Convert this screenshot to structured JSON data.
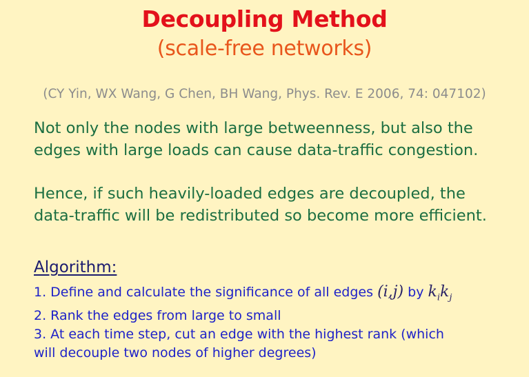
{
  "slide": {
    "title": "Decoupling Method",
    "subtitle": "(scale-free networks)",
    "citation": "(CY Yin, WX Wang, G Chen, BH Wang, Phys. Rev. E 2006, 74: 047102)",
    "paragraph1": {
      "line1": "Not only the nodes with large betweenness, but also the",
      "line2": "edges with large loads can cause data-traffic congestion."
    },
    "paragraph2": {
      "line1": "Hence, if such heavily-loaded edges are decoupled, the",
      "line2": "data-traffic will be redistributed so become more efficient."
    },
    "algorithm": {
      "heading": "Algorithm:",
      "step1_text": "1. Define and calculate the significance of all edges",
      "step1_math_edge": "(i,j)",
      "step1_by": "by",
      "step1_k": "k",
      "step1_sub_i": "i",
      "step1_k2": "k",
      "step1_sub_j": "j",
      "step2": "2. Rank the edges from large to small",
      "step3_line1": "3. At each time step, cut an edge with the highest rank (which",
      "step3_line2": "will decouple two nodes of higher degrees)"
    }
  }
}
